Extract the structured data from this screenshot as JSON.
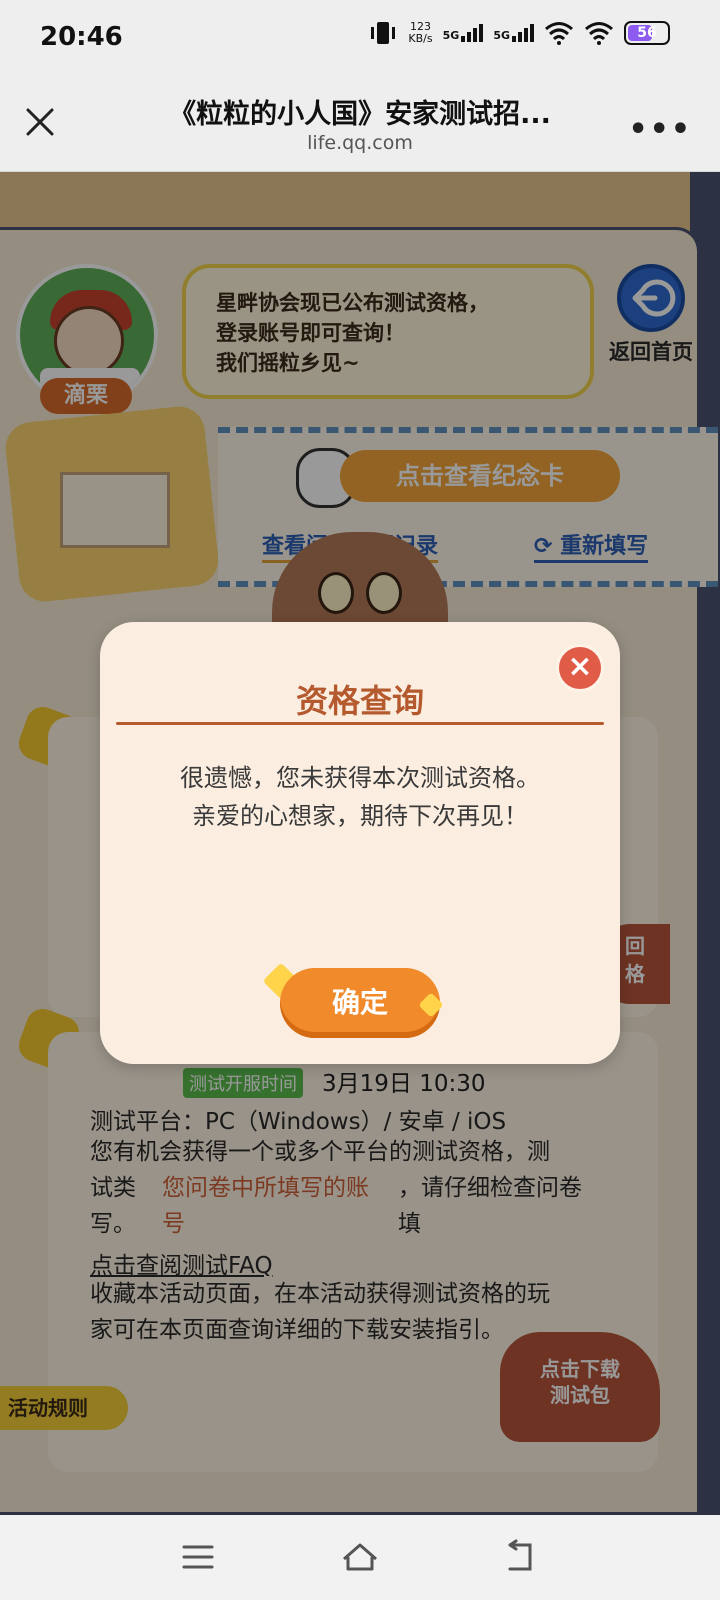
{
  "status_bar": {
    "time": "20:46",
    "net_speed_value": "123",
    "net_speed_unit": "KB/s",
    "sim1": "5G",
    "sim2": "5G",
    "battery": "56"
  },
  "header": {
    "title": "《粒粒的小人国》安家测试招...",
    "url": "life.qq.com"
  },
  "page": {
    "character_name": "滴栗",
    "bubble_lines": [
      "星畔协会现已公布测试资格，",
      "登录账号即可查询！",
      "我们摇粒乡见~"
    ],
    "home_label": "返回首页",
    "memorial_button": "点击查看纪念卡",
    "survey_link": "查看问卷填写记录",
    "refill_link": "重新填写",
    "test_time_badge": "测试开服时间",
    "test_time": "3月19日  10:30",
    "platform_line": "测试平台：PC（Windows）/ 安卓 / iOS",
    "info_line_1": "您有机会获得一个或多个平台的测试资格，测",
    "info_line_2a": "试类",
    "info_line_2b": "您问卷中所填写的账",
    "info_line_2c": "，请仔细检查问卷",
    "info_line_3a": "号",
    "info_line_3b": "填",
    "info_line_3c": "写。",
    "faq_link": "点击查阅测试FAQ",
    "info_line_4": "收藏本活动页面，在本活动获得测试资格的玩",
    "info_line_5": "家可在本页面查询详细的下载安装指引。",
    "download_badge_1": "点击下载",
    "download_badge_2": "测试包",
    "rules_tab": "活动规则",
    "right_tag_1": "回",
    "right_tag_2": "格"
  },
  "dialog": {
    "title": "资格查询",
    "message_line_1": "很遗憾，您未获得本次测试资格。",
    "message_line_2": "亲爱的心想家，期待下次再见！",
    "confirm_label": "确定"
  },
  "colors": {
    "dialog_bg": "#fbeee1",
    "accent": "#b45a2e",
    "confirm": "#f08a2a",
    "close": "#e15c46"
  },
  "icons": {
    "close": "close-icon",
    "more": "more-icon",
    "home": "back-home-icon",
    "refresh": "refresh-icon",
    "nav_menu": "menu-icon",
    "nav_home": "home-icon",
    "nav_back": "back-icon"
  }
}
